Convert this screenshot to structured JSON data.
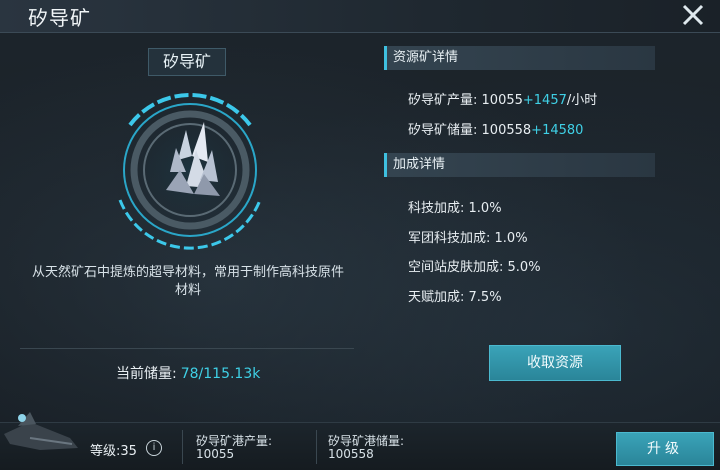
{
  "title": "矽导矿",
  "mineral": {
    "name": "矽导矿",
    "description": "从天然矿石中提炼的超导材料，常用于制作高科技原件材料",
    "storage_label": "当前储量:",
    "storage_value": "78/115.13k",
    "icon": "crystal-icon"
  },
  "resource_details": {
    "heading": "资源矿详情",
    "production_label": "矽导矿产量:",
    "production_value": "10055",
    "production_bonus": "+1457",
    "production_unit": "/小时",
    "reserve_label": "矽导矿储量:",
    "reserve_value": "100558",
    "reserve_bonus": "+14580"
  },
  "bonus_details": {
    "heading": "加成详情",
    "items": [
      {
        "label": "科技加成:",
        "value": "1.0%"
      },
      {
        "label": "军团科技加成:",
        "value": "1.0%"
      },
      {
        "label": "空间站皮肤加成:",
        "value": "5.0%"
      },
      {
        "label": "天赋加成:",
        "value": "7.5%"
      }
    ]
  },
  "actions": {
    "collect_label": "收取资源",
    "upgrade_label": "升级"
  },
  "bottom": {
    "level_label": "等级:35",
    "port_output_label": "矽导矿港产量:",
    "port_output_value": "10055",
    "port_storage_label": "矽导矿港储量:",
    "port_storage_value": "100558"
  },
  "colors": {
    "accent": "#3fd0e6",
    "button": "#2f93a8"
  }
}
